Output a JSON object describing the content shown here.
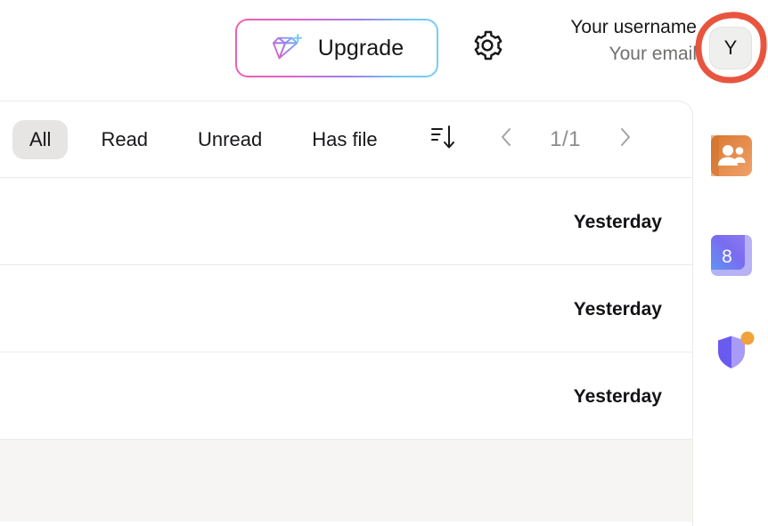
{
  "header": {
    "upgrade": {
      "label": "Upgrade",
      "icon": "diamond-plus-icon"
    },
    "settings_icon": "gear-icon",
    "user": {
      "name": "Your username",
      "email": "Your email",
      "avatar_initial": "Y"
    },
    "annotation": {
      "shape": "hand-drawn-circle",
      "color": "#e8553f",
      "targets": "avatar"
    }
  },
  "colors": {
    "upgrade_gradient_start": "#ef5fb0",
    "upgrade_gradient_end": "#74d0f5",
    "chip_selected_bg": "#e6e5e3",
    "divider": "#eceae7",
    "annotation_red": "#e8553f",
    "footer_bg": "#f6f5f3"
  },
  "list": {
    "filters": [
      {
        "label": "All",
        "selected": true
      },
      {
        "label": "Read",
        "selected": false
      },
      {
        "label": "Unread",
        "selected": false
      },
      {
        "label": "Has file",
        "selected": false
      }
    ],
    "sort_icon": "sort-descending-icon",
    "pager": {
      "prev_icon": "chevron-left-icon",
      "next_icon": "chevron-right-icon",
      "count": "1/1"
    },
    "rows": [
      {
        "time": "Yesterday"
      },
      {
        "time": "Yesterday"
      },
      {
        "time": "Yesterday"
      }
    ]
  },
  "rail": {
    "apps": [
      {
        "name": "contacts-app-icon",
        "badge": null,
        "label": ""
      },
      {
        "name": "onenote-app-icon",
        "badge": null,
        "label": "8"
      },
      {
        "name": "defender-shield-app-icon",
        "badge": "dot",
        "label": ""
      }
    ]
  }
}
